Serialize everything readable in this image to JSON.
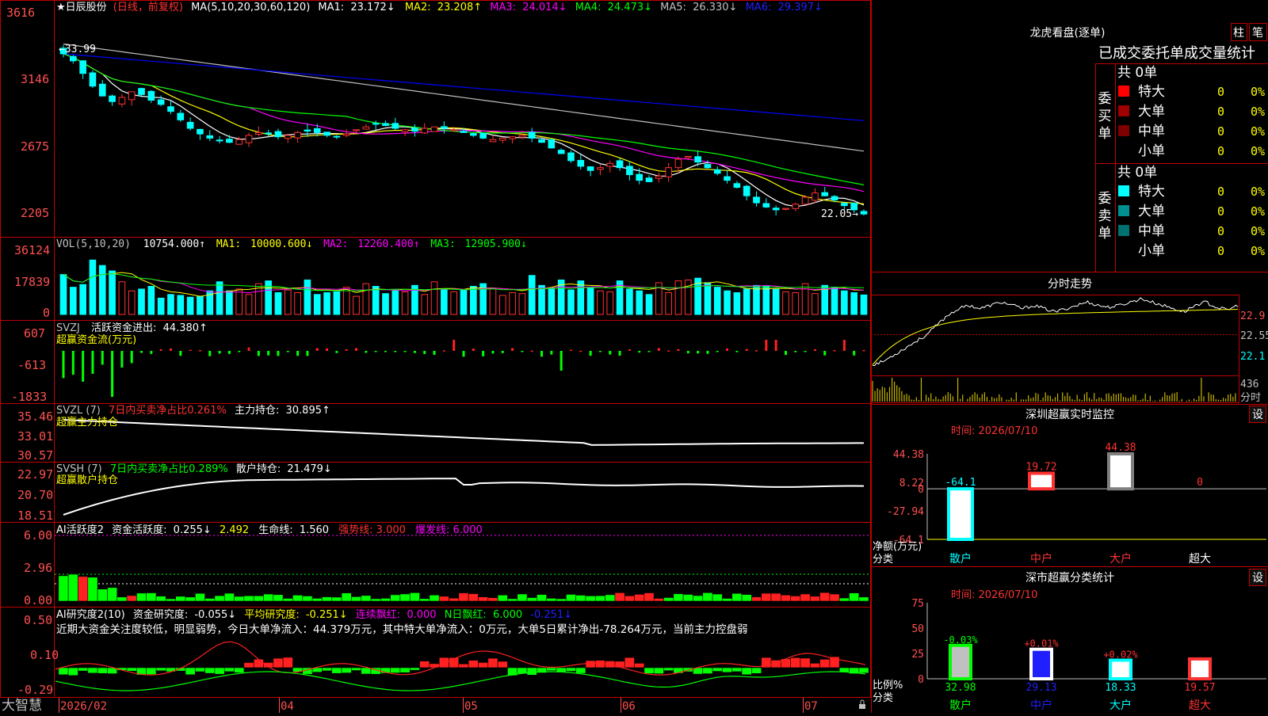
{
  "colors": {
    "up": "#ff3232",
    "down": "#00ffff",
    "ma1": "#ffffff",
    "ma2": "#ffff00",
    "ma3": "#ff00ff",
    "ma4": "#00ff00",
    "ma5": "#c0c0c0",
    "ma6": "#0000ff",
    "frame": "#c00000",
    "axis_text": "#ff5050",
    "bull": "#ff2020",
    "bear": "#00ff00"
  },
  "price_panel": {
    "stock_name": "★日辰股份",
    "period": "(日线，前复权)",
    "ma_params": "MA(5,10,20,30,60,120)",
    "ma_values": [
      {
        "name": "MA1:",
        "value": "23.172↓",
        "color": "#ffffff"
      },
      {
        "name": "MA2:",
        "value": "23.208↑",
        "color": "#ffff00"
      },
      {
        "name": "MA3:",
        "value": "24.014↓",
        "color": "#ff00ff"
      },
      {
        "name": "MA4:",
        "value": "24.473↓",
        "color": "#00ff00"
      },
      {
        "name": "MA5:",
        "value": "26.330↓",
        "color": "#c0c0c0"
      },
      {
        "name": "MA6:",
        "value": "29.397↓",
        "color": "#0000ff"
      }
    ],
    "y_ticks": [
      "3616",
      "3146",
      "2675",
      "2205"
    ],
    "high_label": "←33.99",
    "low_label": "22.05→"
  },
  "vol_panel": {
    "title": "VOL(5,10,20)",
    "value": "10754.000↑",
    "ma_values": [
      {
        "name": "MA1:",
        "value": "10000.600↓",
        "color": "#ffff00"
      },
      {
        "name": "MA2:",
        "value": "12260.400↑",
        "color": "#ff00ff"
      },
      {
        "name": "MA3:",
        "value": "12905.900↓",
        "color": "#00ff00"
      }
    ],
    "y_ticks": [
      "36124",
      "17839",
      "0"
    ]
  },
  "svzj_panel": {
    "title": "SVZJ",
    "label": "活跃资金进出:",
    "value": "44.380↑",
    "subtitle": "超赢资金流(万元)",
    "y_ticks": [
      "607",
      "-613",
      "-1833"
    ]
  },
  "svzl_panel": {
    "title": "SVZL (7)",
    "desc": "7日内买卖净占比0.261%",
    "label": "主力持仓:",
    "value": "30.895↑",
    "subtitle": "超赢主力持仓",
    "y_ticks": [
      "35.46",
      "33.01",
      "30.57"
    ]
  },
  "svsh_panel": {
    "title": "SVSH (7)",
    "desc": "7日内买卖净占比0.289%",
    "label": "散户持仓:",
    "value": "21.479↓",
    "subtitle": "超赢散户持仓",
    "y_ticks": [
      "22.97",
      "20.70",
      "18.51"
    ]
  },
  "ai_active_panel": {
    "title": "AI活跃度2",
    "label1": "资金活跃度:",
    "value1": "0.255↓",
    "value2": "2.492",
    "label3": "生命线:",
    "value3": "1.560",
    "strong": "强势线: 3.000",
    "burst": "爆发线: 6.000",
    "y_ticks": [
      "6.00",
      "2.96",
      "0.00"
    ]
  },
  "ai_research_panel": {
    "title": "AI研究度2(10)",
    "label1": "资金研究度:",
    "value1": "-0.055↓",
    "label2": "平均研究度:",
    "value2": "-0.251↓",
    "label3": "连续飘红:",
    "value3": "0.000",
    "label4": "N日飘红:",
    "value4": "6.000",
    "value5": "-0.251↓",
    "comment": "近期大资金关注度较低，明显弱势，今日大单净流入：44.379万元，其中特大单净流入：0万元，大单5日累计净出-78.264万元，当前主力控盘弱",
    "y_ticks": [
      "0.50",
      "0.10",
      "-0.29"
    ]
  },
  "bottom_bar": {
    "brand": "大智慧",
    "dates": [
      "2026/02",
      "04",
      "05",
      "06",
      "07"
    ]
  },
  "lhb_panel": {
    "title": "龙虎看盘(逐单)",
    "tab_buttons": [
      "柱",
      "笔"
    ],
    "subtitle": "已成交委托单成交量统计",
    "buy_side": {
      "label": "委买单",
      "total": "共 0单",
      "rows": [
        {
          "name": "特大",
          "count": "0",
          "pct": "0%",
          "color": "#ff0000"
        },
        {
          "name": "大单",
          "count": "0",
          "pct": "0%",
          "color": "#a00000"
        },
        {
          "name": "中单",
          "count": "0",
          "pct": "0%",
          "color": "#800000"
        },
        {
          "name": "小单",
          "count": "0",
          "pct": "0%",
          "color": ""
        }
      ]
    },
    "sell_side": {
      "label": "委卖单",
      "total": "共 0单",
      "rows": [
        {
          "name": "特大",
          "count": "0",
          "pct": "0%",
          "color": "#00ffff"
        },
        {
          "name": "大单",
          "count": "0",
          "pct": "0%",
          "color": "#009090"
        },
        {
          "name": "中单",
          "count": "0",
          "pct": "0%",
          "color": "#007070"
        },
        {
          "name": "小单",
          "count": "0",
          "pct": "0%",
          "color": ""
        }
      ]
    }
  },
  "intraday_panel": {
    "title": "分时走势",
    "y_ticks": [
      "22.9",
      "22.55",
      "22.1"
    ],
    "volume_label": "436",
    "time_label": "分时"
  },
  "sz_monitor_panel": {
    "title": "深圳超赢实时监控",
    "button": "设",
    "time": "时间: 2026/07/10",
    "y_ticks": [
      "44.38",
      "8.22",
      "0",
      "-27.94",
      "-64.1"
    ],
    "unit_label": "净额(万元)",
    "cat_label": "分类",
    "categories": [
      "散户",
      "中户",
      "大户",
      "超大"
    ],
    "values": [
      -64.1,
      19.72,
      44.38,
      0
    ],
    "value_labels": [
      "-64.1",
      "19.72",
      "44.38",
      "0"
    ]
  },
  "sz_class_panel": {
    "title": "深市超赢分类统计",
    "button": "设",
    "time": "时间: 2026/07/10",
    "y_ticks": [
      "75",
      "50",
      "25",
      "0"
    ],
    "ratio_label": "比例%",
    "cat_label": "分类",
    "categories": [
      "散户",
      "中户",
      "大户",
      "超大"
    ],
    "values": [
      32.98,
      29.13,
      18.33,
      19.57
    ],
    "value_labels": [
      "32.98",
      "29.13",
      "18.33",
      "19.57"
    ],
    "changes": [
      "-0.03%",
      "+0.01%",
      "+0.02%",
      ""
    ]
  },
  "chart_data": [
    {
      "type": "candlestick",
      "title": "日辰股份 日线 前复权",
      "y_labels": [
        "3616",
        "3146",
        "2675",
        "2205"
      ],
      "ylim": [
        21.5,
        36.6
      ],
      "close": [
        33.9,
        33.4,
        32.5,
        31.6,
        30.9,
        30.5,
        30.8,
        31.2,
        31.0,
        30.6,
        30.3,
        29.8,
        29.2,
        28.6,
        28.2,
        27.9,
        27.7,
        27.6,
        27.8,
        28.1,
        28.3,
        28.2,
        28.0,
        28.1,
        28.3,
        28.4,
        28.3,
        28.1,
        28.0,
        28.2,
        28.5,
        28.7,
        28.9,
        28.8,
        28.6,
        28.5,
        28.4,
        28.6,
        28.7,
        28.6,
        28.5,
        28.3,
        28.1,
        27.9,
        27.8,
        27.9,
        28.0,
        28.1,
        27.9,
        27.6,
        27.2,
        26.8,
        26.3,
        25.9,
        25.6,
        25.8,
        26.1,
        25.8,
        25.3,
        24.9,
        24.8,
        25.2,
        25.8,
        26.4,
        26.6,
        26.2,
        25.8,
        25.4,
        24.9,
        24.4,
        23.8,
        23.3,
        23.0,
        22.8,
        22.9,
        23.2,
        23.7,
        24.0,
        23.8,
        23.5,
        23.1,
        22.8,
        22.5
      ]
    },
    {
      "type": "bar",
      "title": "VOL(5,10,20)",
      "y_labels": [
        "36124",
        "17839",
        "0"
      ],
      "ylim": [
        0,
        38000
      ],
      "values": [
        22000,
        15000,
        16500,
        30000,
        27000,
        24000,
        18000,
        13000,
        14000,
        15500,
        9000,
        11000,
        10500,
        9500,
        10000,
        13000,
        18000,
        13000,
        14000,
        11000,
        17000,
        18500,
        12000,
        13500,
        12000,
        19000,
        11000,
        12000,
        12500,
        15000,
        10000,
        17000,
        15500,
        11500,
        13000,
        12500,
        16000,
        11000,
        18000,
        14000,
        12500,
        13500,
        15500,
        17000,
        14500,
        10500,
        12000,
        11500,
        21500,
        16000,
        14000,
        19000,
        13500,
        18500,
        15000,
        13000,
        12500,
        18500,
        14000,
        13000,
        11000,
        17500,
        12000,
        18500,
        19000,
        20000,
        17500,
        15000,
        13000,
        12000,
        14000,
        16000,
        15500,
        14000,
        12500,
        12000,
        17000,
        11500,
        16000,
        15000,
        13000,
        12000,
        10754
      ]
    },
    {
      "type": "line",
      "title": "分时走势",
      "y_labels": [
        "22.9",
        "22.55",
        "22.1"
      ],
      "ylim": [
        21.9,
        23.1
      ],
      "values": [
        22.05,
        22.1,
        22.2,
        22.3,
        22.4,
        22.5,
        22.65,
        22.8,
        22.9,
        22.95,
        22.9,
        22.95,
        23.0,
        22.95,
        22.9,
        22.95,
        22.9,
        22.85,
        22.9,
        22.95,
        23.0,
        22.95,
        22.92,
        22.95,
        23.0,
        23.05,
        23.0,
        22.95,
        22.9,
        22.85,
        22.95,
        23.0,
        22.92,
        22.88,
        22.95
      ]
    }
  ]
}
